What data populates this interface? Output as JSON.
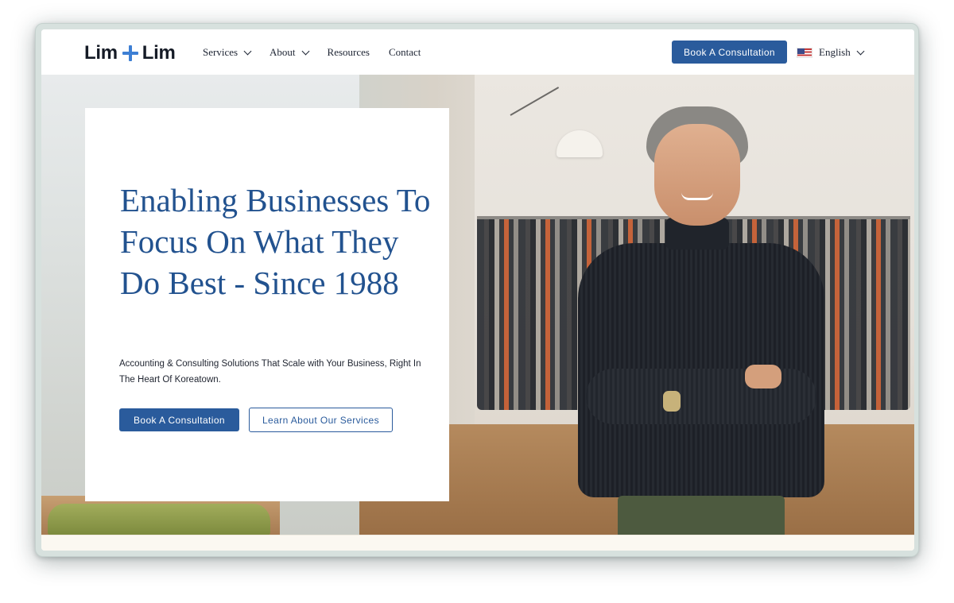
{
  "nav": {
    "logo_left": "Lim",
    "logo_right": "Lim",
    "menu": [
      {
        "label": "Services",
        "has_dropdown": true
      },
      {
        "label": "About",
        "has_dropdown": true
      },
      {
        "label": "Resources",
        "has_dropdown": false
      },
      {
        "label": "Contact",
        "has_dropdown": false
      }
    ],
    "cta_label": "Book A Consultation",
    "language": "English",
    "language_flag_icon": "us-flag-icon"
  },
  "hero": {
    "headline": "Enabling Businesses To Focus On What They Do Best - Since 1988",
    "subtext": "Accounting & Consulting Solutions That Scale with Your Business, Right In The Heart Of Koreatown.",
    "primary_button": "Book A Consultation",
    "secondary_button": "Learn About Our Services"
  },
  "colors": {
    "brand_blue": "#2a5b9c",
    "logo_plus": "#3d7fd4",
    "headline": "#22528f"
  }
}
